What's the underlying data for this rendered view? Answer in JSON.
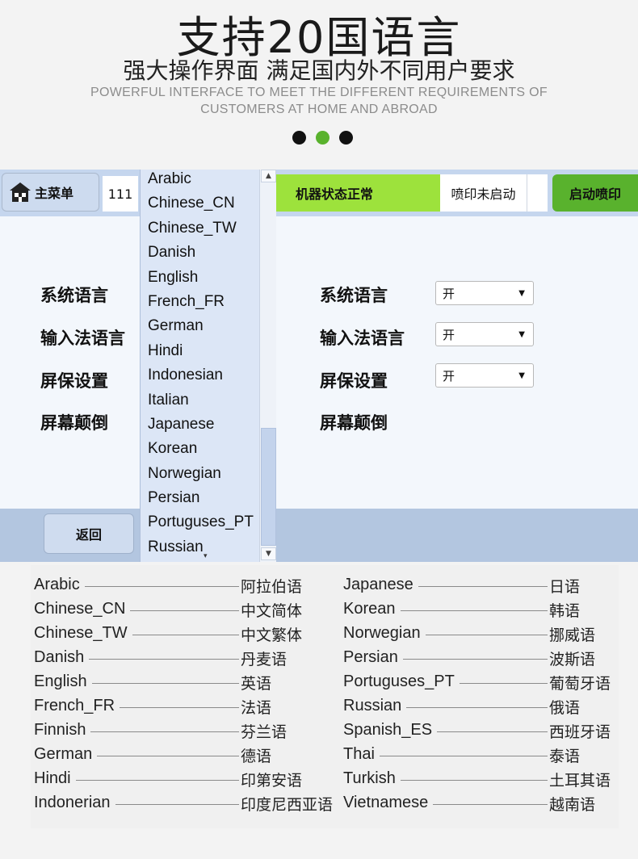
{
  "header": {
    "title": "支持20国语言",
    "subtitle": "强大操作界面 满足国内外不同用户要求",
    "english_line1": "POWERFUL INTERFACE TO MEET THE DIFFERENT REQUIREMENTS OF",
    "english_line2": "CUSTOMERS AT HOME AND ABROAD",
    "dots": [
      "#111111",
      "#59b22d",
      "#111111"
    ]
  },
  "screen": {
    "topbar": {
      "home_label": "主菜单",
      "number": "111",
      "status_ok": "机器状态正常",
      "print_status": "喷印未启动",
      "start_button": "启动喷印"
    },
    "left_settings": [
      "系统语言",
      "输入法语言",
      "屏保设置",
      "屏幕颠倒"
    ],
    "right_settings": [
      {
        "label": "系统语言",
        "value": "开"
      },
      {
        "label": "输入法语言",
        "value": "开"
      },
      {
        "label": "屏保设置",
        "value": "开"
      },
      {
        "label": "屏幕颠倒"
      }
    ],
    "dropdown_items": [
      "Arabic",
      "Chinese_CN",
      "Chinese_TW",
      "Danish",
      "English",
      "French_FR",
      "German",
      "Hindi",
      "Indonesian",
      "Italian",
      "Japanese",
      "Korean",
      "Norwegian",
      "Persian",
      "Portuguses_PT",
      "Russian"
    ],
    "back_button": "返回",
    "colors": {
      "status_green": "#9de23c",
      "start_green": "#59b22d",
      "bar_blue": "#c5d6ee"
    }
  },
  "language_table": {
    "left": [
      {
        "en": "Arabic",
        "zh": "阿拉伯语"
      },
      {
        "en": "Chinese_CN",
        "zh": "中文简体"
      },
      {
        "en": "Chinese_TW",
        "zh": "中文繁体"
      },
      {
        "en": "Danish",
        "zh": "丹麦语"
      },
      {
        "en": "English",
        "zh": "英语"
      },
      {
        "en": "French_FR",
        "zh": "法语"
      },
      {
        "en": "Finnish",
        "zh": "芬兰语"
      },
      {
        "en": "German",
        "zh": "德语"
      },
      {
        "en": "Hindi",
        "zh": "印第安语"
      },
      {
        "en": "Indonerian",
        "zh": "印度尼西亚语"
      }
    ],
    "right": [
      {
        "en": "Japanese",
        "zh": "日语"
      },
      {
        "en": "Korean",
        "zh": "韩语"
      },
      {
        "en": "Norwegian",
        "zh": "挪威语"
      },
      {
        "en": "Persian",
        "zh": "波斯语"
      },
      {
        "en": "Portuguses_PT",
        "zh": "葡萄牙语"
      },
      {
        "en": "Russian",
        "zh": "俄语"
      },
      {
        "en": "Spanish_ES",
        "zh": "西班牙语"
      },
      {
        "en": "Thai",
        "zh": "泰语"
      },
      {
        "en": "Turkish",
        "zh": "土耳其语"
      },
      {
        "en": "Vietnamese",
        "zh": "越南语"
      }
    ]
  }
}
